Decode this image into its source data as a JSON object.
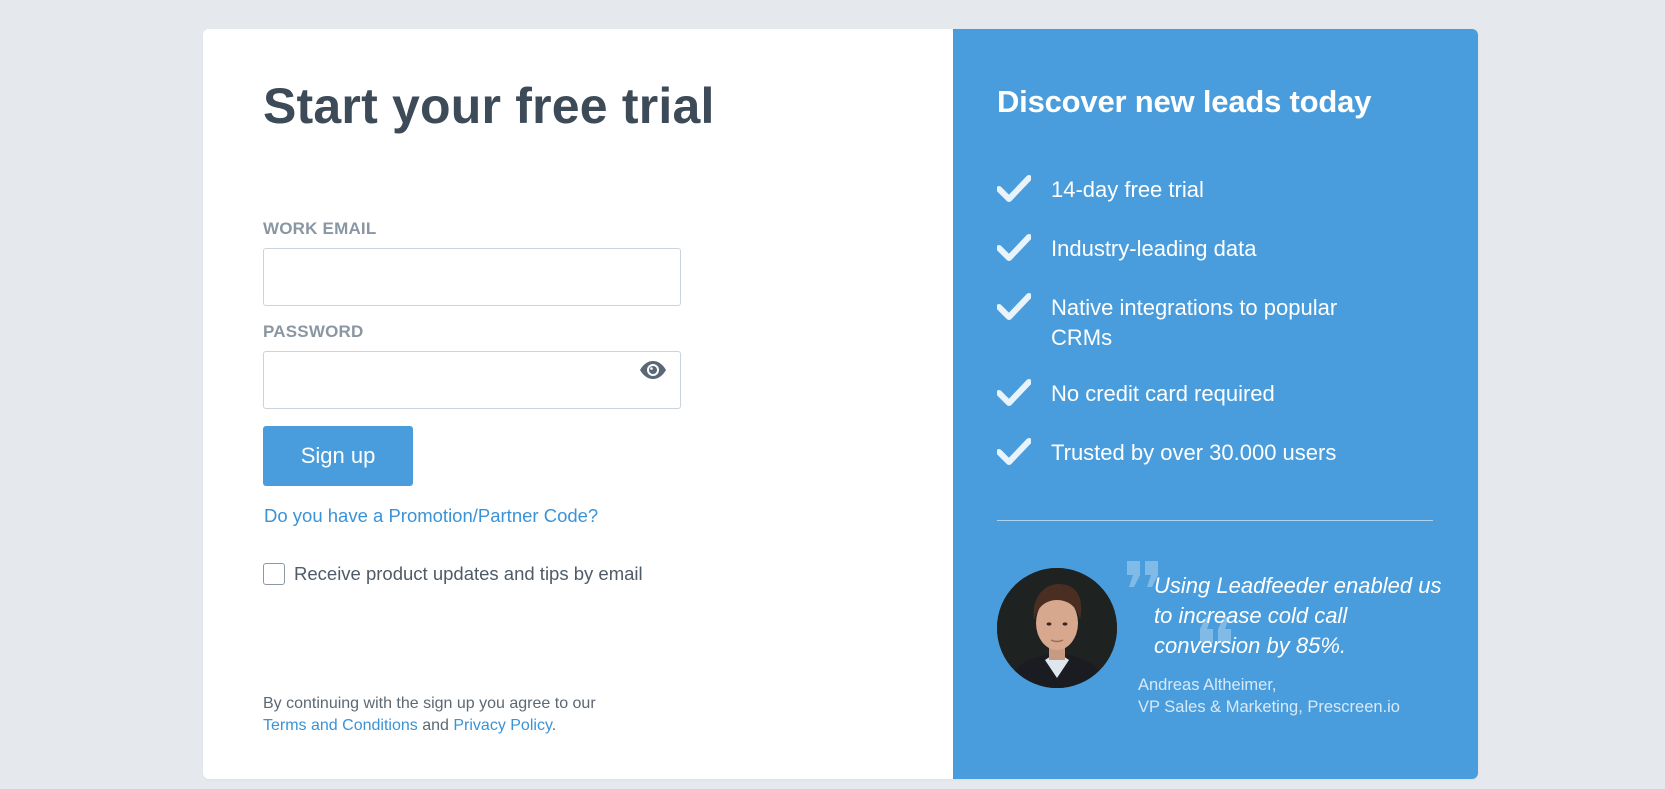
{
  "signup": {
    "title": "Start your free trial",
    "email_label": "WORK EMAIL",
    "email_value": "",
    "password_label": "PASSWORD",
    "password_value": "",
    "submit_label": "Sign up",
    "promo_link": "Do you have a Promotion/Partner Code?",
    "newsletter_label": "Receive product updates and tips by email",
    "newsletter_checked": false,
    "legal_prefix": "By continuing with the sign up you agree to our",
    "terms_link": "Terms and Conditions",
    "legal_and": "and",
    "privacy_link": "Privacy Policy",
    "legal_suffix": "."
  },
  "promo": {
    "title": "Discover new leads today",
    "benefits": [
      "14-day free trial",
      "Industry-leading data",
      "Native integrations to popular CRMs",
      "No credit card required",
      "Trusted by over 30.000 users"
    ],
    "testimonial": {
      "quote": "Using Leadfeeder enabled us to increase cold call conversion by 85%.",
      "author_name": "Andreas Altheimer,",
      "author_role": "VP Sales & Marketing, Prescreen.io"
    }
  },
  "colors": {
    "background": "#e5e9ed",
    "accent": "#4a9ddc",
    "link": "#3a93d6",
    "title": "#3d4a57"
  },
  "icons": {
    "password_toggle": "eye-icon",
    "benefit_bullet": "check-icon",
    "quote": "quote-mark-icon"
  }
}
